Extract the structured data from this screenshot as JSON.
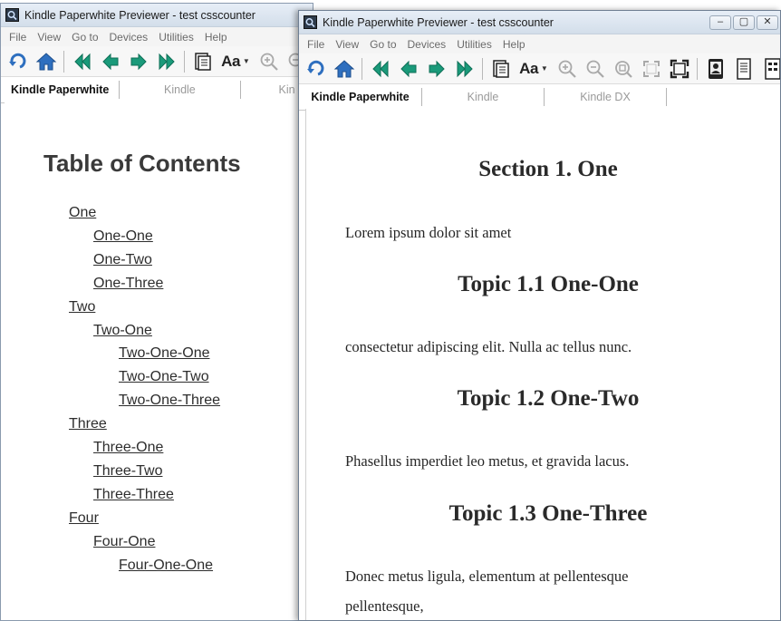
{
  "left_window": {
    "title": "Kindle Paperwhite Previewer - test csscounter",
    "menu": [
      "File",
      "View",
      "Go to",
      "Devices",
      "Utilities",
      "Help"
    ],
    "device_tabs": [
      "Kindle Paperwhite",
      "Kindle",
      "Kin"
    ],
    "toc_title": "Table of Contents",
    "toc_items": [
      {
        "label": "One",
        "level": 1
      },
      {
        "label": "One-One",
        "level": 2
      },
      {
        "label": "One-Two",
        "level": 2
      },
      {
        "label": "One-Three",
        "level": 2
      },
      {
        "label": "Two",
        "level": 1
      },
      {
        "label": "Two-One",
        "level": 2
      },
      {
        "label": "Two-One-One",
        "level": 3
      },
      {
        "label": "Two-One-Two",
        "level": 3
      },
      {
        "label": "Two-One-Three",
        "level": 3
      },
      {
        "label": "Three",
        "level": 1
      },
      {
        "label": "Three-One",
        "level": 2
      },
      {
        "label": "Three-Two",
        "level": 2
      },
      {
        "label": "Three-Three",
        "level": 2
      },
      {
        "label": "Four",
        "level": 1
      },
      {
        "label": "Four-One",
        "level": 2
      },
      {
        "label": "Four-One-One",
        "level": 3
      }
    ]
  },
  "right_window": {
    "title": "Kindle Paperwhite Previewer - test csscounter",
    "menu": [
      "File",
      "View",
      "Go to",
      "Devices",
      "Utilities",
      "Help"
    ],
    "device_tabs": [
      "Kindle Paperwhite",
      "Kindle",
      "Kindle DX"
    ],
    "heading": "Section 1. One",
    "para1": "Lorem ipsum dolor sit amet",
    "topic1": "Topic 1.1 One-One",
    "para2": "consectetur adipiscing elit. Nulla ac tellus nunc.",
    "topic2": "Topic 1.2 One-Two",
    "para3": "Phasellus imperdiet leo metus, et gravida lacus.",
    "topic3": "Topic 1.3 One-Three",
    "para4a": "Donec metus ligula, elementum at pellentesque",
    "para4b": "pellentesque,"
  },
  "toolbar": {
    "font_button_label": "Aa",
    "icons": [
      "rotate-icon",
      "home-icon",
      "first-page-icon",
      "previous-page-icon",
      "next-page-icon",
      "last-page-icon",
      "toc-page-icon",
      "font-size-icon",
      "zoom-in-icon",
      "zoom-out-icon",
      "zoom-fit-icon",
      "fit-page-icon",
      "full-screen-icon",
      "device-portrait-icon",
      "document-icon",
      "grid-view-icon"
    ]
  },
  "colors": {
    "nav_arrow": "#1a9a7a",
    "nav_arrow_dark": "#0f6f57",
    "home": "#2e6fbf",
    "titlebar": "#dfe7f1"
  }
}
